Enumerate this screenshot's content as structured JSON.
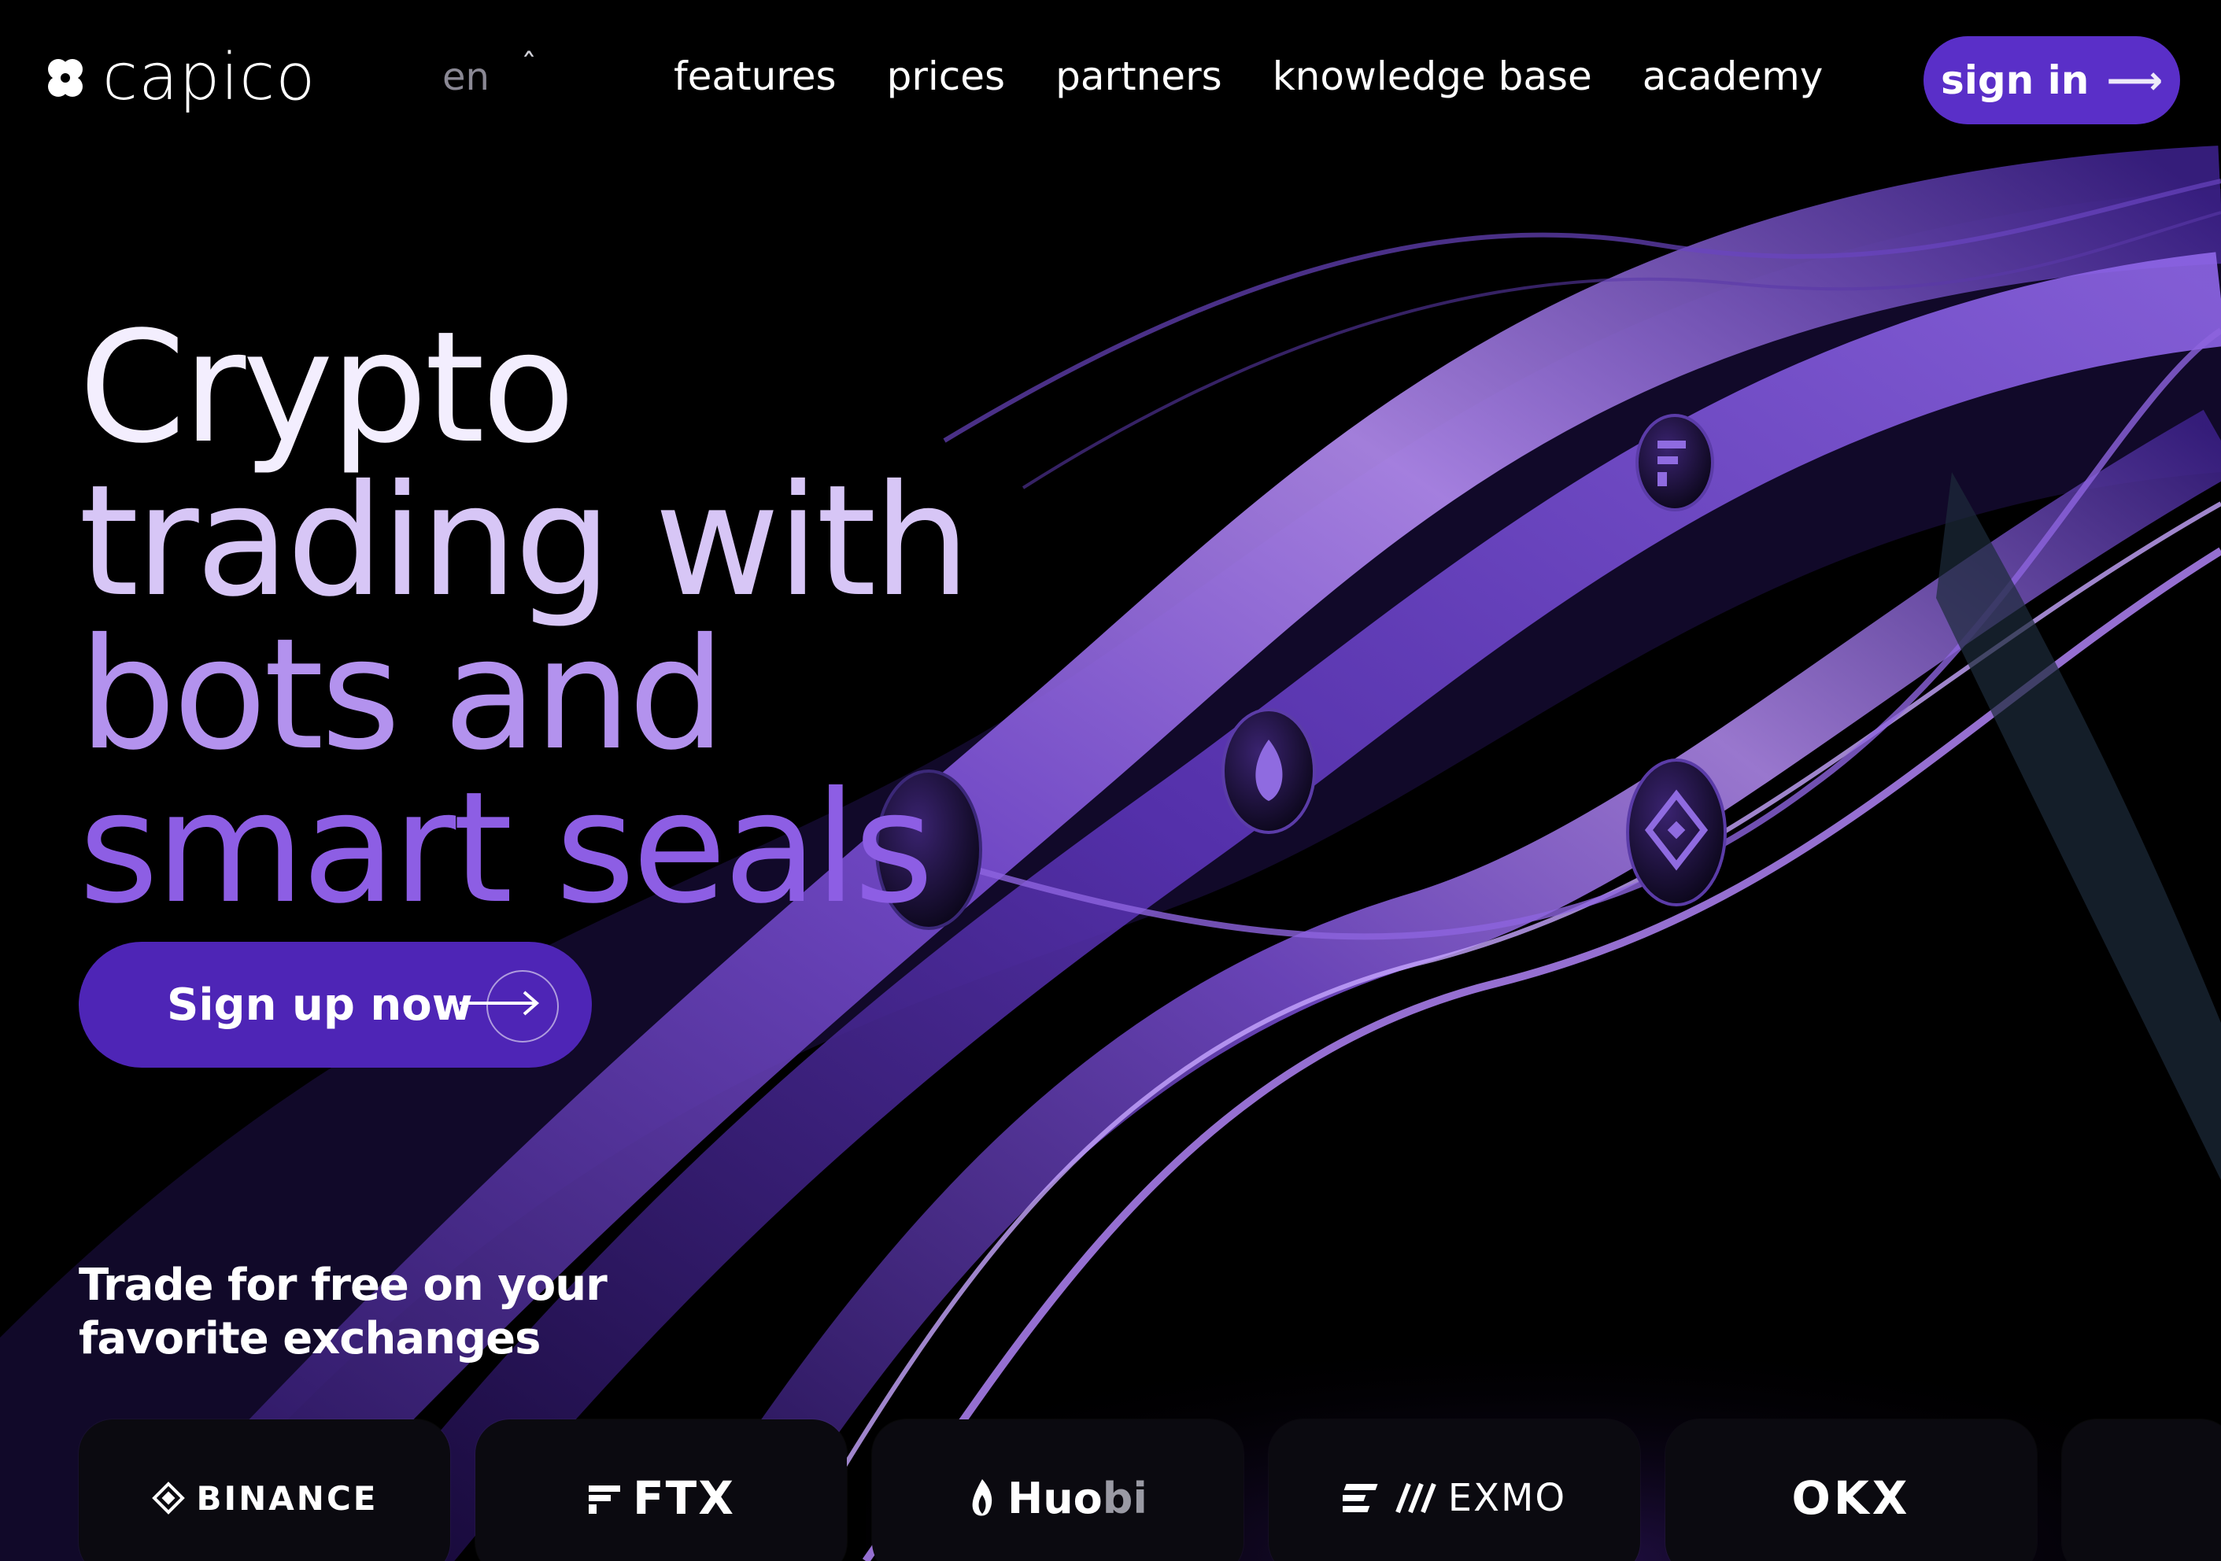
{
  "brand": {
    "name": "capico"
  },
  "language": {
    "current": "en",
    "caret": "ˆ"
  },
  "nav": {
    "items": [
      {
        "label": "features"
      },
      {
        "label": "prices"
      },
      {
        "label": "partners"
      },
      {
        "label": "knowledge base"
      },
      {
        "label": "academy"
      }
    ],
    "signin_label": "sign in",
    "signin_arrow": "⟶"
  },
  "hero": {
    "lines": [
      "Crypto",
      "trading with",
      "bots and",
      "smart seals"
    ],
    "cta_label": "Sign up now"
  },
  "exchanges": {
    "heading_line1": "Trade for free on your",
    "heading_line2": "favorite exchanges",
    "items": [
      {
        "name": "BINANCE"
      },
      {
        "name": "FTX"
      },
      {
        "name_main": "Huo",
        "name_dim": "bi"
      },
      {
        "name": "EXMO"
      },
      {
        "name": "OKX"
      }
    ]
  },
  "colors": {
    "accent": "#5a2fc8",
    "cta": "#4e25b6",
    "background": "#000000",
    "ribbon_purple": "#7b4fd6"
  },
  "icons": [
    "capico-logo-icon",
    "chevron-up-icon",
    "arrow-right-icon",
    "binance-logo-icon",
    "ftx-logo-icon",
    "huobi-flame-icon",
    "exmo-logo-icon"
  ]
}
